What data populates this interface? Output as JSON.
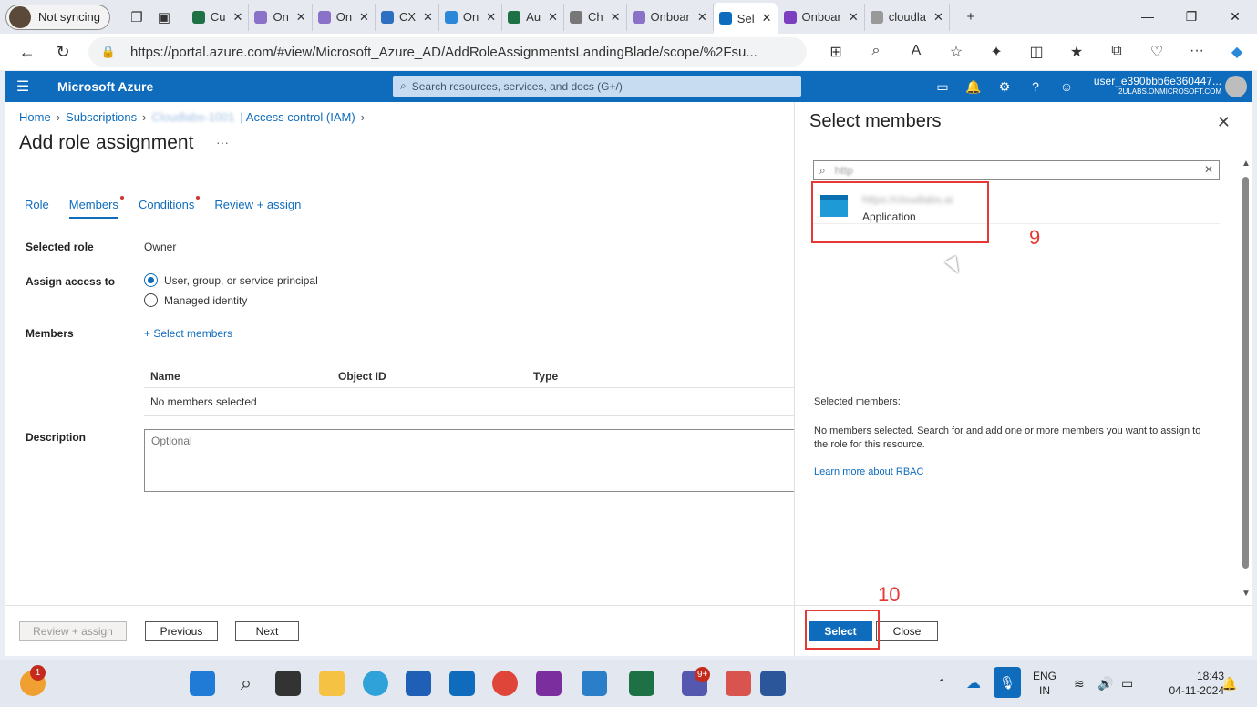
{
  "browser": {
    "profile_label": "Not syncing",
    "tabs": [
      {
        "label": "Cu",
        "color": "#1e7145"
      },
      {
        "label": "On",
        "color": "#8a72c9"
      },
      {
        "label": "On",
        "color": "#8a72c9"
      },
      {
        "label": "CX",
        "color": "#2f6fc0"
      },
      {
        "label": "On",
        "color": "#2b88d8"
      },
      {
        "label": "Au",
        "color": "#1e7145"
      },
      {
        "label": "Ch",
        "color": "#777777"
      },
      {
        "label": "Onboar",
        "color": "#8a72c9"
      },
      {
        "label": "Sel",
        "color": "#0f6cbd",
        "active": true
      },
      {
        "label": "Onboar",
        "color": "#7b3fbf"
      },
      {
        "label": "cloudla",
        "color": "#999999"
      }
    ],
    "url": "https://portal.azure.com/#view/Microsoft_Azure_AD/AddRoleAssignmentsLandingBlade/scope/%2Fsu..."
  },
  "azure": {
    "title": "Microsoft Azure",
    "search_placeholder": "Search resources, services, and docs (G+/)",
    "user_name": "user_e390bbb6e360447...",
    "user_domain": "2ULABS.ONMICROSOFT.COM"
  },
  "breadcrumb": {
    "home": "Home",
    "subscriptions": "Subscriptions",
    "subscription_name": "Cloudlabs-1001",
    "iam": "| Access control (IAM)"
  },
  "page": {
    "title": "Add role assignment",
    "more": "···",
    "tabs": [
      {
        "label": "Role",
        "dot": false
      },
      {
        "label": "Members",
        "dot": true,
        "active": true
      },
      {
        "label": "Conditions",
        "dot": true
      },
      {
        "label": "Review + assign",
        "dot": false
      }
    ],
    "selected_role_label": "Selected role",
    "selected_role_value": "Owner",
    "assign_access_label": "Assign access to",
    "assign_options": [
      "User, group, or service principal",
      "Managed identity"
    ],
    "members_label": "Members",
    "select_members_link": "+ Select members",
    "table_headers": [
      "Name",
      "Object ID",
      "Type"
    ],
    "table_empty": "No members selected",
    "description_label": "Description",
    "description_placeholder": "Optional",
    "btn_review": "Review + assign",
    "btn_previous": "Previous",
    "btn_next": "Next"
  },
  "panel": {
    "title": "Select members",
    "search_value": "http",
    "result_name": "https://cloudlabs.ai",
    "result_type": "Application",
    "annotation_9": "9",
    "annotation_10": "10",
    "selected_members_label": "Selected members:",
    "empty_message": "No members selected. Search for and add one or more members you want to assign to the role for this resource.",
    "learn_more": "Learn more about RBAC",
    "btn_select": "Select",
    "btn_close": "Close"
  },
  "taskbar": {
    "notif_badge": "1",
    "teams_badge": "9+",
    "lang_top": "ENG",
    "lang_bottom": "IN",
    "time": "18:43",
    "date": "04-11-2024"
  }
}
